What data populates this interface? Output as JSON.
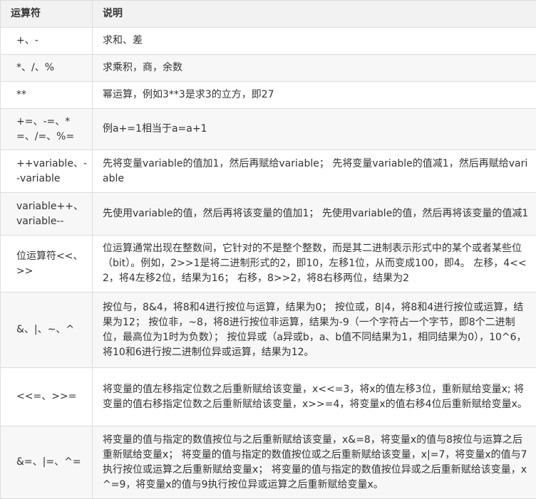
{
  "table": {
    "headers": [
      "运算符",
      "说明"
    ],
    "rows": [
      {
        "op": "+、-",
        "desc": "求和、差"
      },
      {
        "op": "*、/、%",
        "desc": "求乘积，商，余数"
      },
      {
        "op": "**",
        "desc": "幂运算，例如3**3是求3的立方，即27"
      },
      {
        "op": "+=、-=、*=、/=、%=",
        "desc": "例a+=1相当于a=a+1"
      },
      {
        "op": "++variable、--variable",
        "desc": "先将变量variable的值加1，然后再赋给variable； 先将变量variable的值减1，然后再赋给variable"
      },
      {
        "op": "variable++、variable--",
        "desc": "先使用variable的值，然后再将该变量的值加1； 先使用variable的值，然后再将该变量的值减1"
      },
      {
        "op": "位运算符<<、>>",
        "desc": "位运算通常出现在整数间，它针对的不是整个整数，而是其二进制表示形式中的某个或者某些位（bit）。例如，2>>1是将二进制形式的2，即10，左移1位，从而变成100，即4。 左移，4<<2，将4左移2位，结果为16； 右移，8>>2，将8右移两位，结果为2"
      },
      {
        "op": "&、|、~、^",
        "desc": "按位与，8&4，将8和4进行按位与运算，结果为0； 按位或，8|4，将8和4进行按位或运算，结果为12； 按位非，~8，将8进行按位非运算，结果为-9（一个字符占一个字节，即8个二进制位，最高位为1时为负数）； 按位异或（a异或b，a、b值不同结果为1，相同结果为0），10^6，将10和6进行按二进制位异或运算，结果为12。"
      },
      {
        "op": "<<=、>>=",
        "desc": "将变量的值左移指定位数之后重新赋给该变量，x<<=3，将x的值左移3位，重新赋给变量x; 将变量的值右移指定位数之后重新赋给该变量，x>>=4，将变量x的值右移4位后重新赋给变量x。"
      },
      {
        "op": "&=、|=、^=",
        "desc": "将变量的值与指定的数值按位与之后重新赋给该变量，x&=8，将变量x的值与8按位与运算之后重新赋给变量x； 将变量的值与指定的数值按位或之后重新赋给该变量，x|=7，将变量x的值与7执行按位或运算之后重新赋给变量x； 将变量的值与指定的数值按位异或之后重新赋给该变量，x^=9，将变量x的值与9执行按位异或运算之后重新赋给变量x。"
      }
    ]
  }
}
